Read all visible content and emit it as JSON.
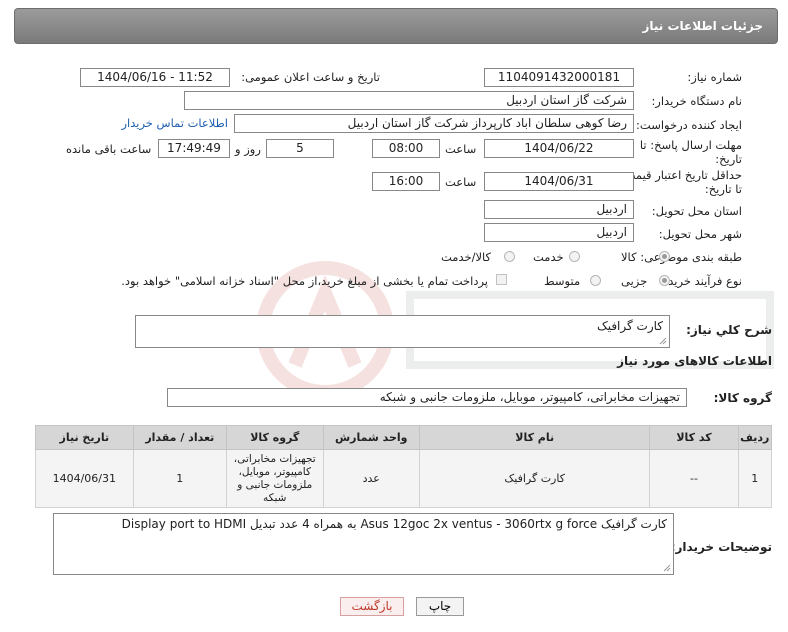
{
  "header": {
    "title": "جزئیات اطلاعات نیاز"
  },
  "fields": {
    "need_number_label": "شماره نیاز:",
    "need_number": "1104091432000181",
    "announce_label": "تاریخ و ساعت اعلان عمومی:",
    "announce_value": "1404/06/16 - 11:52",
    "buyer_org_label": "نام دستگاه خریدار:",
    "buyer_org": "شرکت گاز استان اردبیل",
    "requester_label": "ایجاد کننده درخواست:",
    "requester": "رضا کوهی سلطان اباد کارپرداز شرکت گاز استان اردبیل",
    "contact_link": "اطلاعات تماس خریدار",
    "deadline_label_1": "مهلت ارسال پاسخ: تا",
    "deadline_label_2": "تاریخ:",
    "deadline_date": "1404/06/22",
    "time_word": "ساعت",
    "deadline_time": "08:00",
    "days_value": "5",
    "days_word": "روز و",
    "remaining_time": "17:49:49",
    "remaining_word": "ساعت باقی مانده",
    "price_label_1": "حداقل تاریخ اعتبار قیمت:",
    "price_label_2": "تا تاریخ:",
    "price_date": "1404/06/31",
    "price_time": "16:00",
    "province_label": "استان محل تحویل:",
    "province": "اردبیل",
    "city_label": "شهر محل تحویل:",
    "city": "اردبیل",
    "category_label": "طبقه بندی موضوعی:",
    "category_options": [
      "کالا",
      "خدمت",
      "کالا/خدمت"
    ],
    "process_label": "نوع فرآیند خرید :",
    "process_options": [
      "جزیی",
      "متوسط"
    ],
    "payment_note": "پرداخت تمام یا بخشی از مبلغ خرید،از محل \"اسناد خزانه اسلامی\" خواهد بود.",
    "summary_label": "شرح كلي نياز:",
    "summary": "کارت گرافیک",
    "goods_info_title": "اطلاعات کالاهای مورد نیاز",
    "goods_group_label": "گروه کالا:",
    "goods_group": "تجهیزات مخابراتی، کامپیوتر، موبایل، ملزومات جانبی و شبکه",
    "buyer_notes_label": "توضیحات خریدار:",
    "buyer_notes": "کارت گرافیک Asus 12goc 2x ventus - 3060rtx g force به همراه 4 عدد تبدیل Display port to HDMI"
  },
  "table": {
    "headers": [
      "ردیف",
      "کد کالا",
      "نام کالا",
      "واحد شمارش",
      "گروه کالا",
      "تعداد / مقدار",
      "تاریخ نیاز"
    ],
    "rows": [
      [
        "1",
        "--",
        "کارت گرافیک",
        "عدد",
        "تجهیزات مخابراتی، کامپیوتر، موبایل، ملزومات جانبی و شبکه",
        "1",
        "1404/06/31"
      ]
    ]
  },
  "buttons": {
    "print": "چاپ",
    "back": "بازگشت"
  },
  "colors": {
    "header_bg": "#8a8a8a",
    "link": "#1f5fb0",
    "table_header": "#d6d6d6"
  }
}
